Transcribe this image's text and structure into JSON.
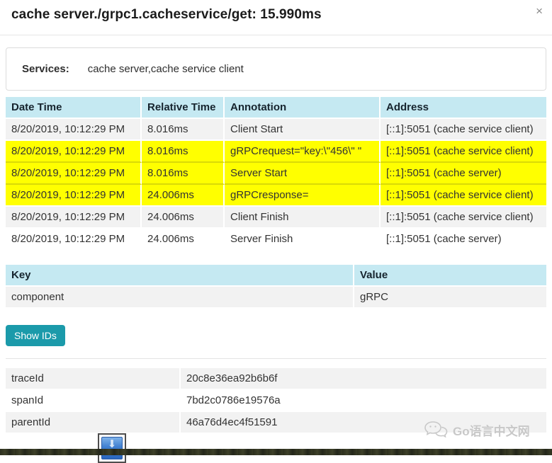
{
  "modal": {
    "title": "cache server./grpc1.cacheservice/get: 15.990ms",
    "close_label": "×"
  },
  "services": {
    "label": "Services:",
    "value": "cache server,cache service client"
  },
  "annotations_table": {
    "headers": [
      "Date Time",
      "Relative Time",
      "Annotation",
      "Address"
    ],
    "rows": [
      {
        "date_time": "8/20/2019, 10:12:29 PM",
        "relative_time": "8.016ms",
        "annotation": "Client Start",
        "address": "[::1]:5051 (cache service client)",
        "highlighted": false
      },
      {
        "date_time": "8/20/2019, 10:12:29 PM",
        "relative_time": "8.016ms",
        "annotation": "gRPCrequest=\"key:\\\"456\\\" \"",
        "address": "[::1]:5051 (cache service client)",
        "highlighted": true
      },
      {
        "date_time": "8/20/2019, 10:12:29 PM",
        "relative_time": "8.016ms",
        "annotation": "Server Start",
        "address": "[::1]:5051 (cache server)",
        "highlighted": true
      },
      {
        "date_time": "8/20/2019, 10:12:29 PM",
        "relative_time": "24.006ms",
        "annotation": "gRPCresponse=",
        "address": "[::1]:5051 (cache service client)",
        "highlighted": true
      },
      {
        "date_time": "8/20/2019, 10:12:29 PM",
        "relative_time": "24.006ms",
        "annotation": "Client Finish",
        "address": "[::1]:5051 (cache service client)",
        "highlighted": false
      },
      {
        "date_time": "8/20/2019, 10:12:29 PM",
        "relative_time": "24.006ms",
        "annotation": "Server Finish",
        "address": "[::1]:5051 (cache server)",
        "highlighted": false
      }
    ]
  },
  "tags_table": {
    "headers": [
      "Key",
      "Value"
    ],
    "rows": [
      {
        "key": "component",
        "value": "gRPC"
      }
    ]
  },
  "buttons": {
    "show_ids": "Show IDs"
  },
  "ids_table": {
    "rows": [
      {
        "label": "traceId",
        "value": "20c8e36ea92b6b6f"
      },
      {
        "label": "spanId",
        "value": "7bd2c0786e19576a"
      },
      {
        "label": "parentId",
        "value": "46a76d4ec4f51591"
      }
    ]
  },
  "watermark": {
    "text": "Go语言中文网"
  },
  "colors": {
    "table_header_bg": "#c5e9f2",
    "row_alt_bg": "#f2f2f2",
    "highlight_bg": "#ffff00",
    "button_bg": "#1b9aaa",
    "title_color": "#1b1b1b"
  }
}
